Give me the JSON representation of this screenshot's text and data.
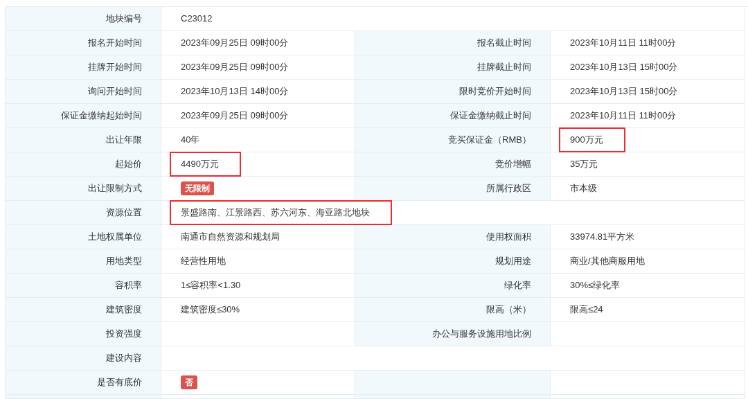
{
  "rows": [
    {
      "cells": [
        {
          "label": "地块编号",
          "value": "C23012",
          "kind": "text"
        }
      ]
    },
    {
      "cells": [
        {
          "label": "报名开始时间",
          "value": "2023年09月25日 09时00分",
          "kind": "text"
        },
        {
          "label": "报名截止时间",
          "value": "2023年10月11日 11时00分",
          "kind": "text"
        }
      ]
    },
    {
      "cells": [
        {
          "label": "挂牌开始时间",
          "value": "2023年09月25日 09时00分",
          "kind": "text"
        },
        {
          "label": "挂牌截止时间",
          "value": "2023年10月13日 15时00分",
          "kind": "text"
        }
      ]
    },
    {
      "cells": [
        {
          "label": "询问开始时间",
          "value": "2023年10月13日 14时00分",
          "kind": "text"
        },
        {
          "label": "限时竞价开始时间",
          "value": "2023年10月13日 15时00分",
          "kind": "text"
        }
      ]
    },
    {
      "cells": [
        {
          "label": "保证金缴纳起始时间",
          "value": "2023年09月25日 09时00分",
          "kind": "text"
        },
        {
          "label": "保证金缴纳截止时间",
          "value": "2023年10月11日 11时00分",
          "kind": "text"
        }
      ]
    },
    {
      "cells": [
        {
          "label": "出让年限",
          "value": "40年",
          "kind": "text"
        },
        {
          "label": "竞买保证金（RMB）",
          "value": "900万元",
          "kind": "text",
          "highlighted": true
        }
      ]
    },
    {
      "cells": [
        {
          "label": "起始价",
          "value": "4490万元",
          "kind": "text",
          "highlighted": true
        },
        {
          "label": "竞价增幅",
          "value": "35万元",
          "kind": "text"
        }
      ]
    },
    {
      "cells": [
        {
          "label": "出让限制方式",
          "value": "无限制",
          "kind": "badge"
        },
        {
          "label": "所属行政区",
          "value": "市本级",
          "kind": "text"
        }
      ]
    },
    {
      "cells": [
        {
          "label": "资源位置",
          "value": "景盛路南、江景路西、苏六河东、海亚路北地块",
          "kind": "text",
          "highlighted": true
        }
      ]
    },
    {
      "cells": [
        {
          "label": "土地权属单位",
          "value": "南通市自然资源和规划局",
          "kind": "text"
        },
        {
          "label": "使用权面积",
          "value": "33974.81平方米",
          "kind": "text"
        }
      ]
    },
    {
      "cells": [
        {
          "label": "用地类型",
          "value": "经营性用地",
          "kind": "text"
        },
        {
          "label": "规划用途",
          "value": "商业/其他商服用地",
          "kind": "text"
        }
      ]
    },
    {
      "cells": [
        {
          "label": "容积率",
          "value": "1≤容积率<1.30",
          "kind": "text"
        },
        {
          "label": "绿化率",
          "value": "30%≤绿化率",
          "kind": "text"
        }
      ]
    },
    {
      "cells": [
        {
          "label": "建筑密度",
          "value": "建筑密度≤30%",
          "kind": "text"
        },
        {
          "label": "限高（米）",
          "value": "限高≤24",
          "kind": "text"
        }
      ]
    },
    {
      "cells": [
        {
          "label": "投资强度",
          "kind": "text"
        },
        {
          "label": "办公与服务设施用地比例",
          "kind": "text"
        }
      ]
    },
    {
      "cells": [
        {
          "label": "建设内容",
          "kind": "text"
        }
      ]
    },
    {
      "cells": [
        {
          "label": "是否有底价",
          "value": "否",
          "kind": "badge"
        },
        {
          "kind": "blank"
        }
      ]
    }
  ]
}
